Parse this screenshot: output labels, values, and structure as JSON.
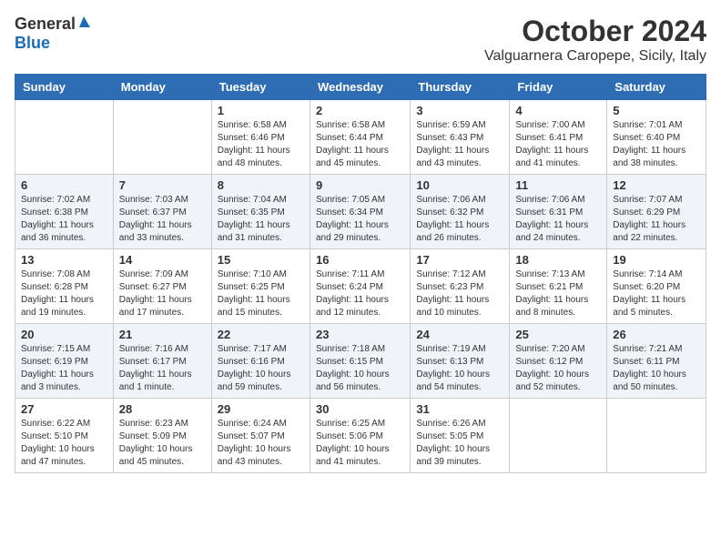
{
  "logo": {
    "general": "General",
    "blue": "Blue"
  },
  "title": {
    "month_year": "October 2024",
    "location": "Valguarnera Caropepe, Sicily, Italy"
  },
  "days_of_week": [
    "Sunday",
    "Monday",
    "Tuesday",
    "Wednesday",
    "Thursday",
    "Friday",
    "Saturday"
  ],
  "weeks": [
    [
      {
        "day": "",
        "info": ""
      },
      {
        "day": "",
        "info": ""
      },
      {
        "day": "1",
        "info": "Sunrise: 6:58 AM\nSunset: 6:46 PM\nDaylight: 11 hours and 48 minutes."
      },
      {
        "day": "2",
        "info": "Sunrise: 6:58 AM\nSunset: 6:44 PM\nDaylight: 11 hours and 45 minutes."
      },
      {
        "day": "3",
        "info": "Sunrise: 6:59 AM\nSunset: 6:43 PM\nDaylight: 11 hours and 43 minutes."
      },
      {
        "day": "4",
        "info": "Sunrise: 7:00 AM\nSunset: 6:41 PM\nDaylight: 11 hours and 41 minutes."
      },
      {
        "day": "5",
        "info": "Sunrise: 7:01 AM\nSunset: 6:40 PM\nDaylight: 11 hours and 38 minutes."
      }
    ],
    [
      {
        "day": "6",
        "info": "Sunrise: 7:02 AM\nSunset: 6:38 PM\nDaylight: 11 hours and 36 minutes."
      },
      {
        "day": "7",
        "info": "Sunrise: 7:03 AM\nSunset: 6:37 PM\nDaylight: 11 hours and 33 minutes."
      },
      {
        "day": "8",
        "info": "Sunrise: 7:04 AM\nSunset: 6:35 PM\nDaylight: 11 hours and 31 minutes."
      },
      {
        "day": "9",
        "info": "Sunrise: 7:05 AM\nSunset: 6:34 PM\nDaylight: 11 hours and 29 minutes."
      },
      {
        "day": "10",
        "info": "Sunrise: 7:06 AM\nSunset: 6:32 PM\nDaylight: 11 hours and 26 minutes."
      },
      {
        "day": "11",
        "info": "Sunrise: 7:06 AM\nSunset: 6:31 PM\nDaylight: 11 hours and 24 minutes."
      },
      {
        "day": "12",
        "info": "Sunrise: 7:07 AM\nSunset: 6:29 PM\nDaylight: 11 hours and 22 minutes."
      }
    ],
    [
      {
        "day": "13",
        "info": "Sunrise: 7:08 AM\nSunset: 6:28 PM\nDaylight: 11 hours and 19 minutes."
      },
      {
        "day": "14",
        "info": "Sunrise: 7:09 AM\nSunset: 6:27 PM\nDaylight: 11 hours and 17 minutes."
      },
      {
        "day": "15",
        "info": "Sunrise: 7:10 AM\nSunset: 6:25 PM\nDaylight: 11 hours and 15 minutes."
      },
      {
        "day": "16",
        "info": "Sunrise: 7:11 AM\nSunset: 6:24 PM\nDaylight: 11 hours and 12 minutes."
      },
      {
        "day": "17",
        "info": "Sunrise: 7:12 AM\nSunset: 6:23 PM\nDaylight: 11 hours and 10 minutes."
      },
      {
        "day": "18",
        "info": "Sunrise: 7:13 AM\nSunset: 6:21 PM\nDaylight: 11 hours and 8 minutes."
      },
      {
        "day": "19",
        "info": "Sunrise: 7:14 AM\nSunset: 6:20 PM\nDaylight: 11 hours and 5 minutes."
      }
    ],
    [
      {
        "day": "20",
        "info": "Sunrise: 7:15 AM\nSunset: 6:19 PM\nDaylight: 11 hours and 3 minutes."
      },
      {
        "day": "21",
        "info": "Sunrise: 7:16 AM\nSunset: 6:17 PM\nDaylight: 11 hours and 1 minute."
      },
      {
        "day": "22",
        "info": "Sunrise: 7:17 AM\nSunset: 6:16 PM\nDaylight: 10 hours and 59 minutes."
      },
      {
        "day": "23",
        "info": "Sunrise: 7:18 AM\nSunset: 6:15 PM\nDaylight: 10 hours and 56 minutes."
      },
      {
        "day": "24",
        "info": "Sunrise: 7:19 AM\nSunset: 6:13 PM\nDaylight: 10 hours and 54 minutes."
      },
      {
        "day": "25",
        "info": "Sunrise: 7:20 AM\nSunset: 6:12 PM\nDaylight: 10 hours and 52 minutes."
      },
      {
        "day": "26",
        "info": "Sunrise: 7:21 AM\nSunset: 6:11 PM\nDaylight: 10 hours and 50 minutes."
      }
    ],
    [
      {
        "day": "27",
        "info": "Sunrise: 6:22 AM\nSunset: 5:10 PM\nDaylight: 10 hours and 47 minutes."
      },
      {
        "day": "28",
        "info": "Sunrise: 6:23 AM\nSunset: 5:09 PM\nDaylight: 10 hours and 45 minutes."
      },
      {
        "day": "29",
        "info": "Sunrise: 6:24 AM\nSunset: 5:07 PM\nDaylight: 10 hours and 43 minutes."
      },
      {
        "day": "30",
        "info": "Sunrise: 6:25 AM\nSunset: 5:06 PM\nDaylight: 10 hours and 41 minutes."
      },
      {
        "day": "31",
        "info": "Sunrise: 6:26 AM\nSunset: 5:05 PM\nDaylight: 10 hours and 39 minutes."
      },
      {
        "day": "",
        "info": ""
      },
      {
        "day": "",
        "info": ""
      }
    ]
  ]
}
